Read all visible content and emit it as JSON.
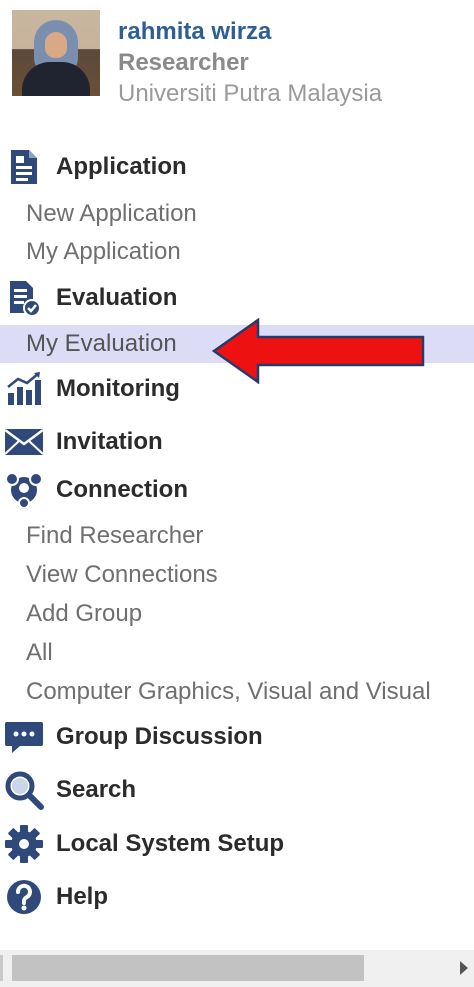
{
  "profile": {
    "name": "rahmita wirza",
    "role": "Researcher",
    "institution": "Universiti Putra Malaysia"
  },
  "menu": {
    "application": {
      "label": "Application",
      "items": [
        "New Application",
        "My Application"
      ]
    },
    "evaluation": {
      "label": "Evaluation",
      "items": [
        "My Evaluation"
      ]
    },
    "monitoring": {
      "label": "Monitoring"
    },
    "invitation": {
      "label": "Invitation"
    },
    "connection": {
      "label": "Connection",
      "items": [
        "Find Researcher",
        "View Connections",
        "Add Group",
        "All",
        "Computer Graphics, Visual and Visual"
      ]
    },
    "group_discussion": {
      "label": "Group Discussion"
    },
    "search": {
      "label": "Search"
    },
    "local_system_setup": {
      "label": "Local System Setup"
    },
    "help": {
      "label": "Help"
    }
  },
  "icons": {
    "application": "document-icon",
    "evaluation": "evaluation-check-icon",
    "monitoring": "bar-chart-icon",
    "invitation": "envelope-icon",
    "connection": "network-icon",
    "group_discussion": "chat-bubble-icon",
    "search": "magnifier-icon",
    "local_system_setup": "gear-icon",
    "help": "question-icon"
  },
  "colors": {
    "icon": "#2f4a7a",
    "active_row": "#dcdcf7",
    "annotation_arrow": "#ee1111",
    "name": "#2d5f96"
  }
}
